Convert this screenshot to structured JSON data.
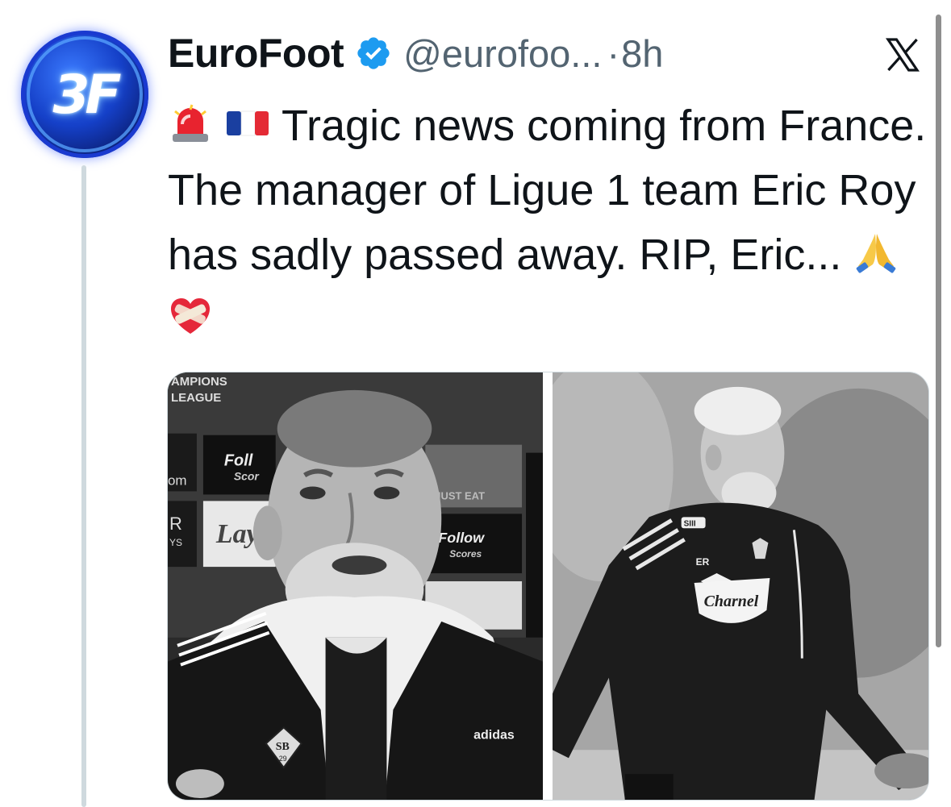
{
  "author": {
    "display_name": "EuroFoot",
    "handle": "@eurofoo...",
    "separator": "·",
    "time": "8h",
    "avatar_text": "3F",
    "verified_icon": "verified-badge-icon"
  },
  "tweet": {
    "text": "Tragic news coming from France. The manager of Ligue 1 team Eric Roy has sadly passed away. RIP, Eric...",
    "leading_emoji": [
      "police-light-icon",
      "france-flag-icon"
    ],
    "trailing_emoji": [
      "folded-hands-icon",
      "heart-bandage-icon"
    ]
  },
  "media": {
    "left_photo": {
      "backdrop_texts": [
        "AMPIONS",
        "LEAGUE",
        "om",
        "R",
        "YS",
        "Foll",
        "Scor",
        "Lay",
        "JUST EAT",
        "Follow",
        "Scores"
      ],
      "kit_texts": [
        "SB",
        "29",
        "adidas"
      ]
    },
    "right_photo": {
      "kit_texts": [
        "SIII",
        "ER",
        "Charnel"
      ]
    }
  },
  "colors": {
    "text_primary": "#0f1419",
    "text_secondary": "#536471",
    "verified_blue": "#1d9bf0",
    "thread_line": "#cfd9de"
  }
}
